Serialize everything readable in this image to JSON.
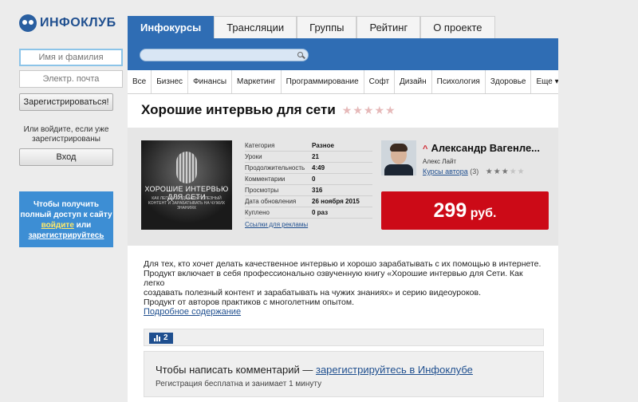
{
  "logo": {
    "text": "ИНФОКЛУБ"
  },
  "auth": {
    "name_placeholder": "Имя и фамилия",
    "email_placeholder": "Электр. почта",
    "register_label": "Зарегистрироваться!",
    "or_text": "Или войдите, если уже зарегистрированы",
    "login_label": "Вход"
  },
  "promo": {
    "text_before": "Чтобы получить полный доступ к сайту",
    "login_link": "войдите",
    "text_mid": "или",
    "register_link": "зарегистрируйтесь"
  },
  "nav": {
    "tabs": [
      {
        "label": "Инфокурсы",
        "active": true
      },
      {
        "label": "Трансляции",
        "active": false
      },
      {
        "label": "Группы",
        "active": false
      },
      {
        "label": "Рейтинг",
        "active": false
      },
      {
        "label": "О проекте",
        "active": false
      }
    ]
  },
  "search": {
    "placeholder": ""
  },
  "categories": [
    "Все",
    "Бизнес",
    "Финансы",
    "Маркетинг",
    "Программирование",
    "Софт",
    "Дизайн",
    "Психология",
    "Здоровье",
    "Еще ▾"
  ],
  "course": {
    "title": "Хорошие интервью для сети",
    "rating_stars": "★★★★★",
    "cover_title": "ХОРОШИЕ ИНТЕРВЬЮ ДЛЯ СЕТИ",
    "cover_subtitle": "КАК ЛЕГКО СОЗДАВАТЬ ПОЛЕЗНЫЙ КОНТЕНТ И ЗАРАБАТЫВАТЬ НА ЧУЖИХ ЗНАНИЯХ",
    "meta": [
      {
        "key": "Категория",
        "value": "Разное"
      },
      {
        "key": "Уроки",
        "value": "21"
      },
      {
        "key": "Продолжительность",
        "value": "4:49"
      },
      {
        "key": "Комментарии",
        "value": "0"
      },
      {
        "key": "Просмотры",
        "value": "316"
      },
      {
        "key": "Дата обновления",
        "value": "26 ноября 2015"
      },
      {
        "key": "Куплено",
        "value": "0 раз"
      }
    ],
    "ad_links": "Ссылки для рекламы",
    "price_value": "299",
    "price_currency": "руб.",
    "description_lines": [
      "Для тех, кто хочет делать качественное интервью и хорошо зарабатывать с их помощью в интернете.",
      "Продукт включает в себя профессионально озвученную книгу «Хорошие интервью для Сети. Как легко",
      "создавать полезный контент и зарабатывать на чужих знаниях» и серию видеоуроков.",
      "Продукт от авторов практиков с многолетним опытом."
    ],
    "toc_link": "Подробное содержание",
    "stats_count": "2"
  },
  "author": {
    "name": "Александр Вагенле...",
    "sub": "Алекс Лайт",
    "courses_label": "Курсы автора",
    "courses_count": "(3)",
    "rating": 2.5
  },
  "comments": {
    "prompt": "Чтобы написать комментарий —",
    "link": "зарегистрируйтесь в Инфоклубе",
    "sub": "Регистрация бесплатна и занимает 1 минуту"
  },
  "colors": {
    "brand_blue": "#2f6db4",
    "price_red": "#cc0a17",
    "promo_blue": "#3d8ed4",
    "link_blue": "#1f4f8f"
  }
}
